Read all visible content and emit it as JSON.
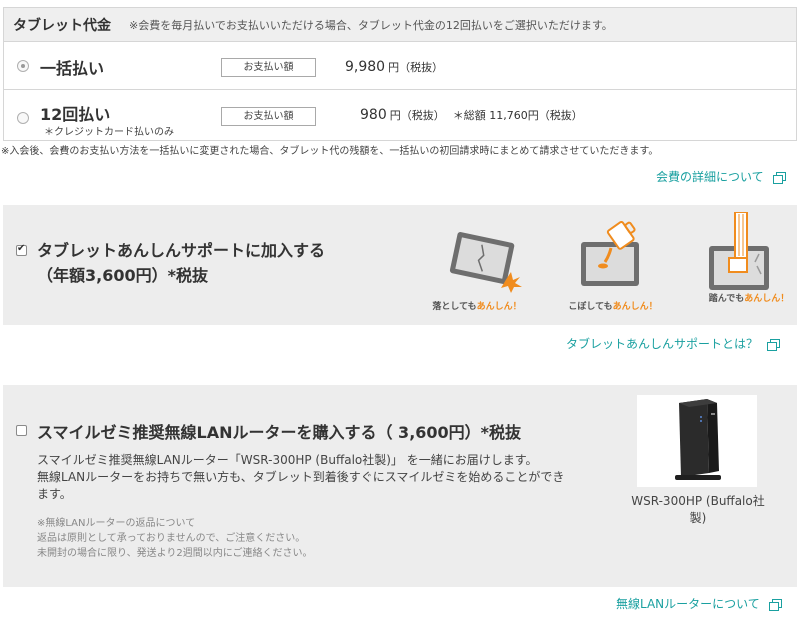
{
  "price_section": {
    "title": "タブレット代金",
    "note": "※会費を毎月払いでお支払いいただける場合、タブレット代金の12回払いをご選択いただけます。",
    "options": [
      {
        "name": "一括払い",
        "sub": "",
        "pay_label": "お支払い額",
        "amount": "9,980",
        "unit": "円（税抜）",
        "extra": ""
      },
      {
        "name": "12回払い",
        "sub": "＊クレジットカード払いのみ",
        "pay_label": "お支払い額",
        "amount": "980",
        "unit": "円（税抜）",
        "extra": "＊総額 11,760円（税抜）"
      }
    ],
    "selected_index": 0
  },
  "price_footnote": "※入会後、会費のお支払い方法を一括払いに変更された場合、タブレット代の残額を、一括払いの初回請求時にまとめて請求させていただきます。",
  "links": {
    "membership_fee": "会費の詳細について",
    "support_about": "タブレットあんしんサポートとは？",
    "router_about": "無線LANルーターについて"
  },
  "support": {
    "checked": true,
    "title_line1": "タブレットあんしんサポートに加入する",
    "title_line2": "（年額3,600円）*税抜",
    "illustrations": [
      {
        "icon": "dropped-tablet-icon",
        "caption_prefix": "落としても",
        "caption_hl": "あんしん！"
      },
      {
        "icon": "spilled-tablet-icon",
        "caption_prefix": "こぼしても",
        "caption_hl": "あんしん！"
      },
      {
        "icon": "stepped-tablet-icon",
        "caption_prefix": "踏んでも",
        "caption_hl": "あんしん！"
      }
    ]
  },
  "router": {
    "checked": false,
    "title": "スマイルゼミ推奨無線LANルーターを購入する（ 3,600円）*税抜",
    "desc_line1": "スマイルゼミ推奨無線LANルーター「WSR-300HP (Buffalo社製)」 を一緒にお届けします。",
    "desc_line2": "無線LANルーターをお持ちで無い方も、タブレット到着後すぐにスマイルゼミを始めることができます。",
    "return_line1": "※無線LANルーターの返品について",
    "return_line2": "返品は原則として承っておりませんので、ご注意ください。",
    "return_line3": "未開封の場合に限り、発送より2週間以内にご連絡ください。",
    "product_caption": "WSR-300HP (Buffalo社製)"
  },
  "colors": {
    "accent_link": "#1aa0a0",
    "highlight_orange": "#f08c1e",
    "panel_bg": "#ededed"
  }
}
